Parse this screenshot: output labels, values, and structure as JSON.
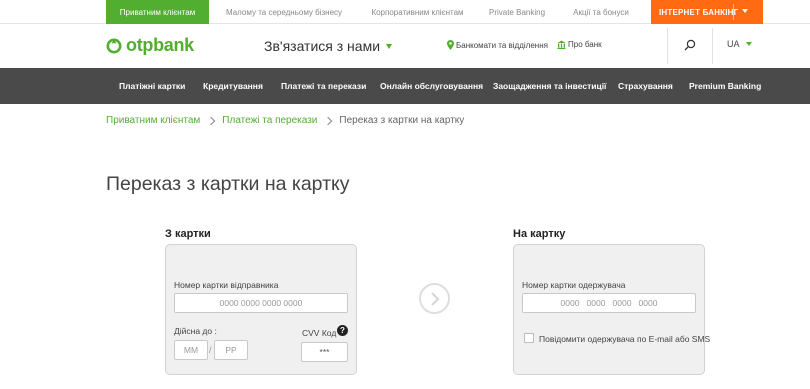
{
  "topbar": {
    "segments": [
      "Приватним клієнтам",
      "Малому та середньому бізнесу",
      "Корпоративним клієнтам",
      "Private Banking",
      "Акції та бонуси"
    ],
    "internet_banking": "ІНТЕРНЕТ БАНКІНГ"
  },
  "header": {
    "logo_text": "otpbank",
    "contact": "Зв'язатися з нами",
    "atms": "Банкомати та відділення",
    "about": "Про банк",
    "lang": "UA"
  },
  "nav": [
    "Платіжні картки",
    "Кредитування",
    "Платежі та перекази",
    "Онлайн обслуговування",
    "Заощадження та інвестиції",
    "Страхування",
    "Premium Banking"
  ],
  "breadcrumb": [
    "Приватним клієнтам",
    "Платежі та перекази",
    "Переказ з картки на картку"
  ],
  "page_title": "Переказ з картки на картку",
  "from_card": {
    "title": "З картки",
    "number_label": "Номер картки відправника",
    "number_placeholder": "0000 0000 0000 0000",
    "expiry_label": "Дійсна до :",
    "month_placeholder": "ММ",
    "year_placeholder": "РР",
    "slash": "/",
    "cvv_label": "CVV Код",
    "cvv_placeholder": "***",
    "help": "?"
  },
  "to_card": {
    "title": "На картку",
    "number_label": "Номер картки одержувача",
    "number_placeholder": "0000   0000   0000   0000",
    "notify_label": "Повідомити одержувача по E-mail або SMS"
  },
  "colors": {
    "brand_green": "#52ae30",
    "internet_banking_orange": "#ff6a13",
    "nav_bg": "#4a4a4a"
  }
}
